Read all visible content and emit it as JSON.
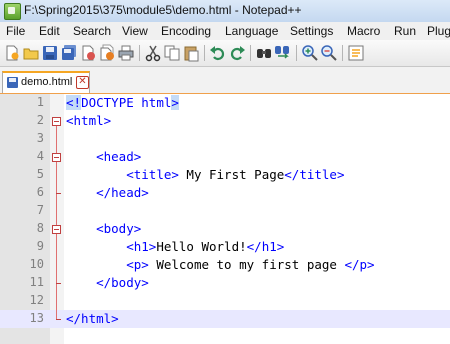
{
  "window": {
    "title": "F:\\Spring2015\\375\\module5\\demo.html - Notepad++"
  },
  "menu": [
    "File",
    "Edit",
    "Search",
    "View",
    "Encoding",
    "Language",
    "Settings",
    "Macro",
    "Run",
    "Plug"
  ],
  "toolbar": {
    "buttons": [
      "new-file-icon",
      "open-file-icon",
      "save-icon",
      "save-all-icon",
      "close-icon",
      "close-all-icon",
      "print-icon",
      "cut-icon",
      "copy-icon",
      "paste-icon",
      "undo-icon",
      "redo-icon",
      "find-icon",
      "replace-icon",
      "zoom-in-icon",
      "zoom-out-icon",
      "sync-icon"
    ]
  },
  "tab": {
    "label": "demo.html",
    "close_glyph": "✕"
  },
  "editor": {
    "lines": [
      {
        "n": "1",
        "indent": "",
        "parts": [
          {
            "c": "t hl",
            "s": "<!"
          },
          {
            "c": "t",
            "s": "DOCTYPE html"
          },
          {
            "c": "t hl",
            "s": ">"
          }
        ]
      },
      {
        "n": "2",
        "indent": "",
        "parts": [
          {
            "c": "t",
            "s": "<html>"
          }
        ]
      },
      {
        "n": "3",
        "indent": "",
        "parts": []
      },
      {
        "n": "4",
        "indent": "    ",
        "parts": [
          {
            "c": "t",
            "s": "<head>"
          }
        ]
      },
      {
        "n": "5",
        "indent": "        ",
        "parts": [
          {
            "c": "t",
            "s": "<title>"
          },
          {
            "c": "",
            "s": " My First Page"
          },
          {
            "c": "t",
            "s": "</title>"
          }
        ]
      },
      {
        "n": "6",
        "indent": "    ",
        "parts": [
          {
            "c": "t",
            "s": "</head>"
          }
        ]
      },
      {
        "n": "7",
        "indent": "",
        "parts": []
      },
      {
        "n": "8",
        "indent": "    ",
        "parts": [
          {
            "c": "t",
            "s": "<body>"
          }
        ]
      },
      {
        "n": "9",
        "indent": "        ",
        "parts": [
          {
            "c": "t",
            "s": "<h1>"
          },
          {
            "c": "",
            "s": "Hello World!"
          },
          {
            "c": "t",
            "s": "</h1>"
          }
        ]
      },
      {
        "n": "10",
        "indent": "        ",
        "parts": [
          {
            "c": "t",
            "s": "<p>"
          },
          {
            "c": "",
            "s": " Welcome to my first page "
          },
          {
            "c": "t",
            "s": "</p>"
          }
        ]
      },
      {
        "n": "11",
        "indent": "    ",
        "parts": [
          {
            "c": "t",
            "s": "</body>"
          }
        ]
      },
      {
        "n": "12",
        "indent": "",
        "parts": []
      },
      {
        "n": "13",
        "indent": "",
        "parts": [
          {
            "c": "t",
            "s": "</html>"
          }
        ],
        "current": true
      }
    ]
  },
  "colors": {
    "tag": "#0000ff",
    "text": "#000000",
    "gutter": "#e4e4e4",
    "current_line": "#e8e8ff",
    "brace_highlight": "#c4dbf7",
    "fold_marker": "#c04040",
    "tab_accent": "#f5a623"
  }
}
